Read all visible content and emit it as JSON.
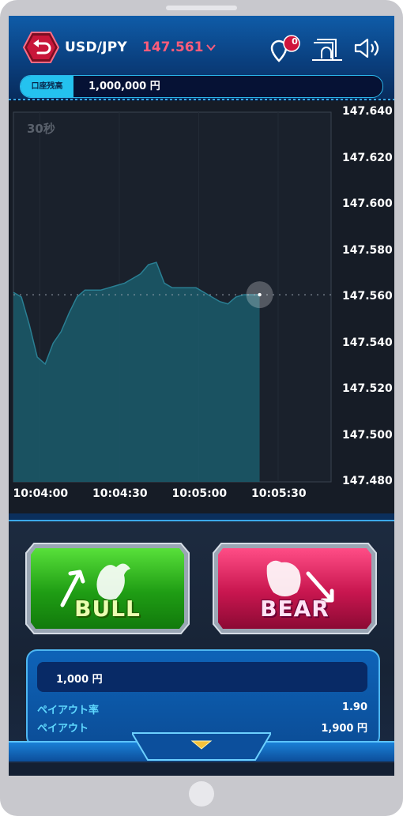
{
  "header": {
    "pair": "USD/JPY",
    "price": "147.561",
    "notification_count": "0"
  },
  "balance": {
    "label": "口座残高",
    "value": "1,000,000 円"
  },
  "chart_data": {
    "type": "area",
    "period_label": "30秒",
    "y_ticks": [
      "147.640",
      "147.620",
      "147.600",
      "147.580",
      "147.560",
      "147.540",
      "147.520",
      "147.500",
      "147.480"
    ],
    "x_ticks": [
      "10:04:00",
      "10:04:30",
      "10:05:00",
      "10:05:30"
    ],
    "ylim": [
      147.48,
      147.64
    ],
    "current_value": 147.561,
    "x": [
      0,
      3,
      6,
      9,
      12,
      15,
      18,
      21,
      24,
      27,
      30,
      33,
      36,
      39,
      42,
      45,
      48,
      51,
      54,
      57,
      60,
      63,
      66,
      69,
      72,
      75,
      78,
      81,
      84,
      87,
      90,
      93
    ],
    "values": [
      147.562,
      147.56,
      147.548,
      147.534,
      147.531,
      147.54,
      147.545,
      147.553,
      147.56,
      147.563,
      147.563,
      147.563,
      147.564,
      147.565,
      147.566,
      147.568,
      147.57,
      147.574,
      147.575,
      147.566,
      147.564,
      147.564,
      147.564,
      147.564,
      147.562,
      147.56,
      147.558,
      147.557,
      147.56,
      147.561,
      147.561,
      147.561
    ]
  },
  "controls": {
    "bull_label": "BULL",
    "bear_label": "BEAR",
    "amount": "1,000 円",
    "payout_rate_label": "ペイアウト率",
    "payout_rate_value": "1.90",
    "payout_label": "ペイアウト",
    "payout_value": "1,900 円"
  },
  "colors": {
    "price_down": "#ff5c7a",
    "chart_fill": "#1b5a6b",
    "bull_green": "#3cc02c",
    "bear_pink": "#e0245e",
    "accent_cyan": "#24c2ef"
  }
}
